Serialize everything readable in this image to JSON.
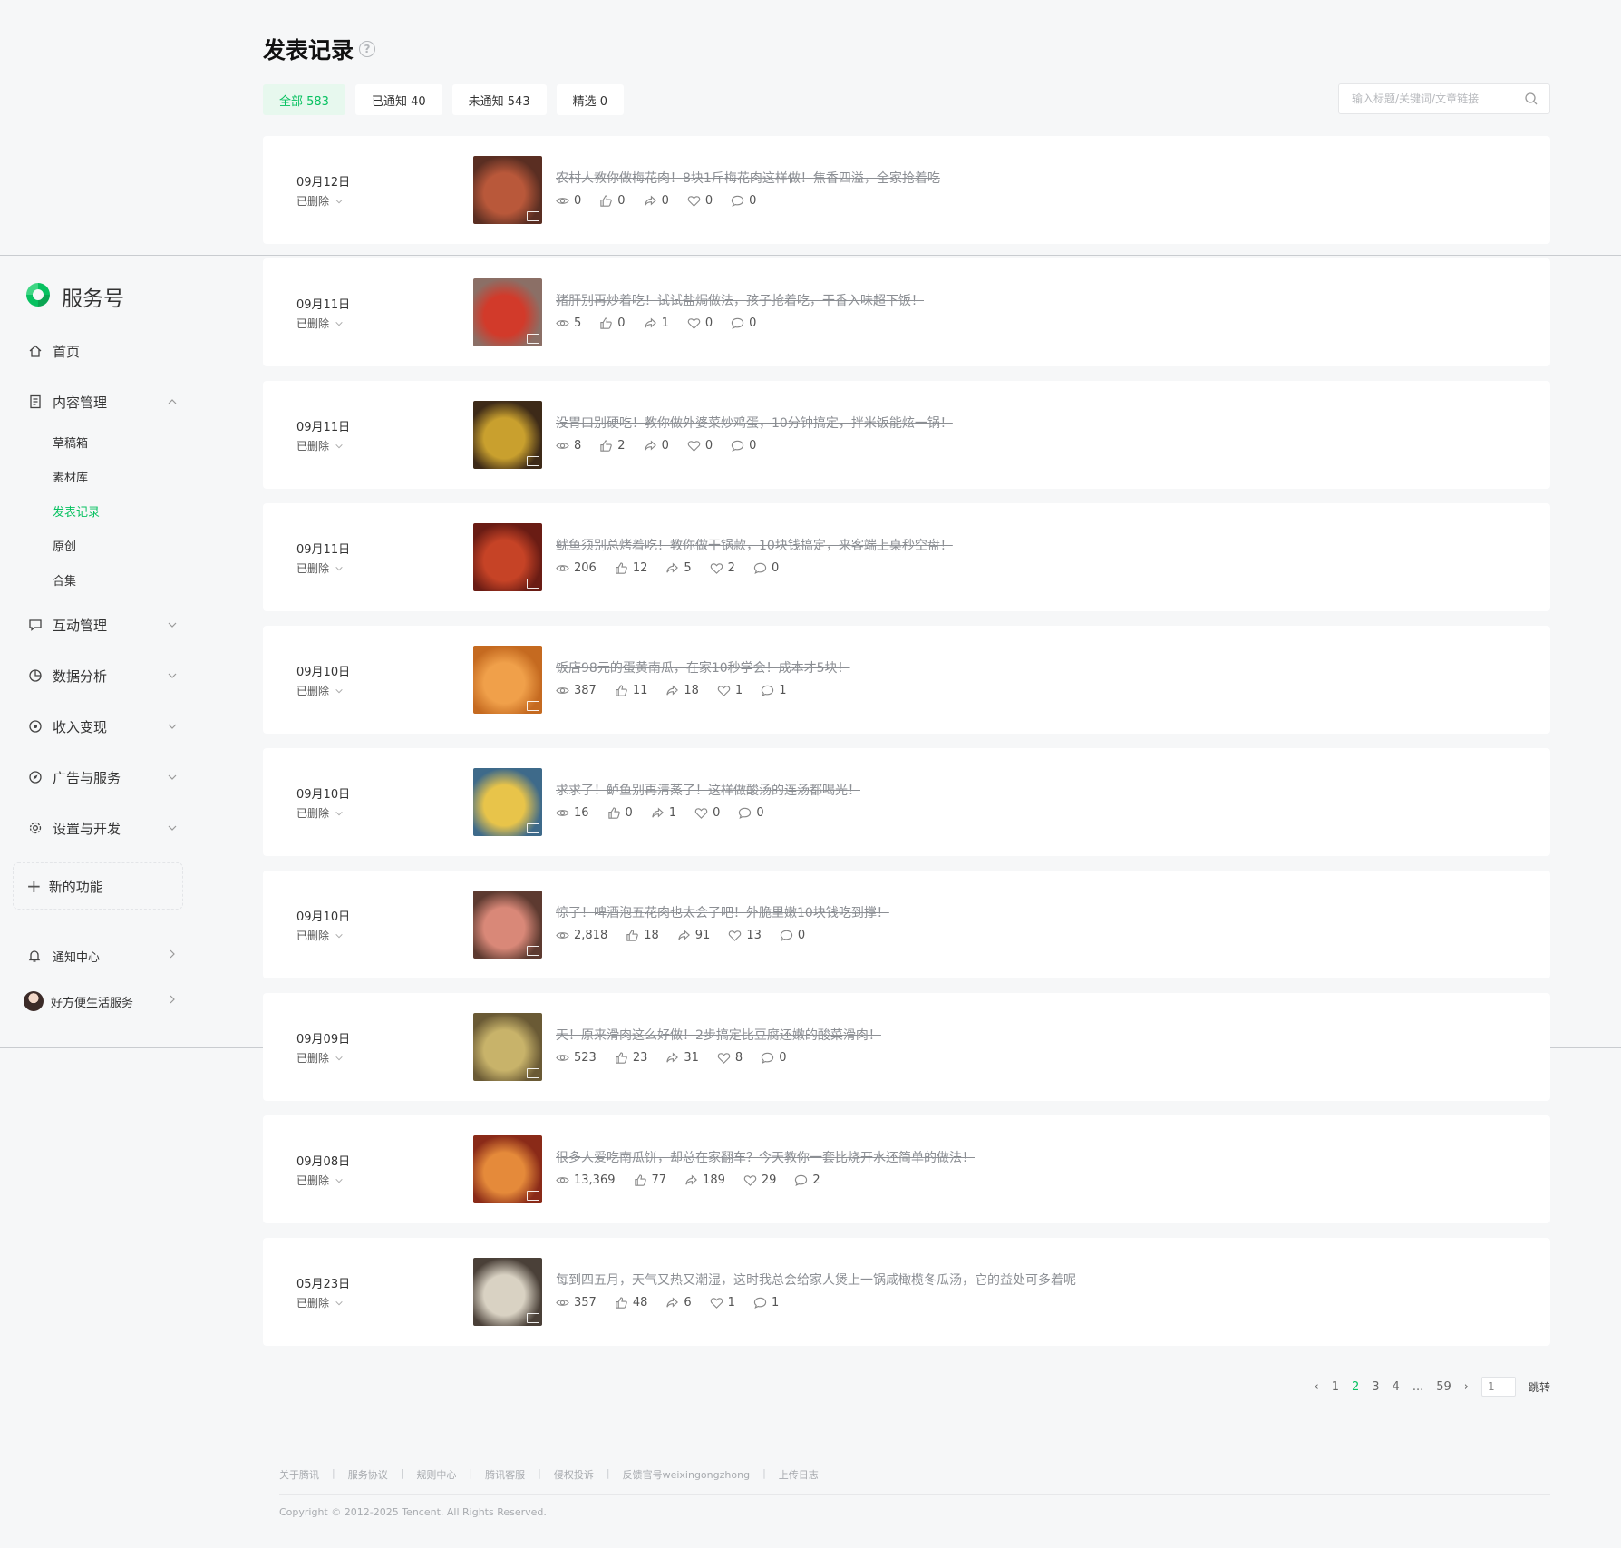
{
  "sidebar": {
    "brand": "服务号",
    "nav": {
      "home": "首页",
      "content": "内容管理",
      "interaction": "互动管理",
      "analytics": "数据分析",
      "revenue": "收入变现",
      "ads": "广告与服务",
      "settings": "设置与开发"
    },
    "sub_items": [
      "草稿箱",
      "素材库",
      "发表记录",
      "原创",
      "合集"
    ],
    "active_sub": "发表记录",
    "new_feature": "新的功能",
    "notifications": "通知中心",
    "account": "好方便生活服务"
  },
  "header": {
    "title": "发表记录",
    "help_glyph": "?",
    "tabs": [
      "全部 583",
      "已通知 40",
      "未通知 543",
      "精选 0"
    ],
    "search_placeholder": "输入标题/关键词/文章链接"
  },
  "articles": [
    {
      "date": "09月12日",
      "status": "已删除",
      "title": "农村人教你做梅花肉！8块1斤梅花肉这样做！焦香四溢，全家抢着吃",
      "stats": [
        "0",
        "0",
        "0",
        "0",
        "0"
      ],
      "thumb_color": [
        "#5a2e22",
        "#b9583a"
      ]
    },
    {
      "date": "09月11日",
      "status": "已删除",
      "title": "猪肝别再炒着吃！试试盐焗做法，孩子抢着吃，干香入味超下饭！",
      "stats": [
        "5",
        "0",
        "1",
        "0",
        "0"
      ],
      "thumb_color": [
        "#8b6f66",
        "#d23a2a"
      ]
    },
    {
      "date": "09月11日",
      "status": "已删除",
      "title": "没胃口别硬吃！教你做外婆菜炒鸡蛋，10分钟搞定，拌米饭能炫一锅！",
      "stats": [
        "8",
        "2",
        "0",
        "0",
        "0"
      ],
      "thumb_color": [
        "#3d2a18",
        "#c9a02e"
      ]
    },
    {
      "date": "09月11日",
      "status": "已删除",
      "title": "鱿鱼须别总烤着吃！教你做干锅款，10块钱搞定，来客端上桌秒空盘！",
      "stats": [
        "206",
        "12",
        "5",
        "2",
        "0"
      ],
      "thumb_color": [
        "#6a1c14",
        "#c64326"
      ]
    },
    {
      "date": "09月10日",
      "status": "已删除",
      "title": "饭店98元的蛋黄南瓜，在家10秒学会！成本才5块！",
      "stats": [
        "387",
        "11",
        "18",
        "1",
        "1"
      ],
      "thumb_color": [
        "#c56a20",
        "#f0a04a"
      ]
    },
    {
      "date": "09月10日",
      "status": "已删除",
      "title": "求求了！鲈鱼别再清蒸了！这样做酸汤的连汤都喝光！",
      "stats": [
        "16",
        "0",
        "1",
        "0",
        "0"
      ],
      "thumb_color": [
        "#3e6a8a",
        "#e8c44a"
      ]
    },
    {
      "date": "09月10日",
      "status": "已删除",
      "title": "惊了！啤酒泡五花肉也太会了吧！外脆里嫩10块钱吃到撑！",
      "stats": [
        "2,818",
        "18",
        "91",
        "13",
        "0"
      ],
      "thumb_color": [
        "#5d3a30",
        "#d98878"
      ]
    },
    {
      "date": "09月09日",
      "status": "已删除",
      "title": "天！原来滑肉这么好做！2步搞定比豆腐还嫩的酸菜滑肉！",
      "stats": [
        "523",
        "23",
        "31",
        "8",
        "0"
      ],
      "thumb_color": [
        "#6a5a35",
        "#c8b36a"
      ]
    },
    {
      "date": "09月08日",
      "status": "已删除",
      "title": "很多人爱吃南瓜饼，却总在家翻车？今天教你一套比烧开水还简单的做法！",
      "stats": [
        "13,369",
        "77",
        "189",
        "29",
        "2"
      ],
      "thumb_color": [
        "#8a2a18",
        "#e58a3a"
      ]
    },
    {
      "date": "05月23日",
      "status": "已删除",
      "title": "每到四五月，天气又热又潮湿，这时我总会给家人煲上一锅咸橄榄冬瓜汤，它的益处可多着呢",
      "stats": [
        "357",
        "48",
        "6",
        "1",
        "1"
      ],
      "thumb_color": [
        "#4a4038",
        "#d9d2c3"
      ]
    }
  ],
  "pagination": {
    "prev": "‹",
    "pages": [
      "1",
      "2",
      "3",
      "4",
      "...",
      "59"
    ],
    "current": "2",
    "next": "›",
    "input_value": "1",
    "jump_label": "跳转"
  },
  "footer": {
    "links": [
      "关于腾讯",
      "服务协议",
      "规则中心",
      "腾讯客服",
      "侵权投诉",
      "反馈官号weixingongzhong",
      "上传日志"
    ],
    "copyright": "Copyright © 2012-2025 Tencent. All Rights Reserved."
  },
  "colors": {
    "accent": "#07c160",
    "background": "#f6f7f8",
    "card": "#ffffff"
  }
}
